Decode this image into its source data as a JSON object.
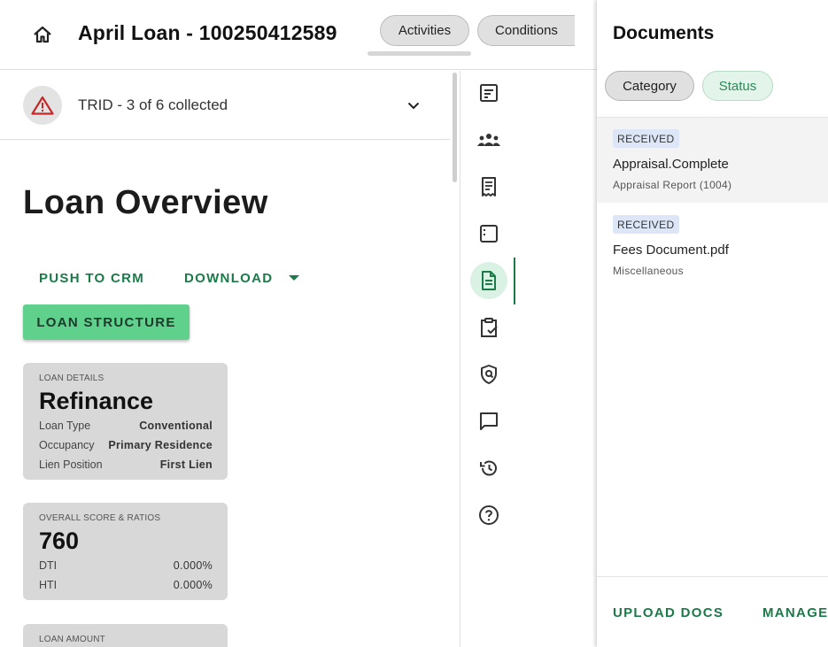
{
  "header": {
    "loan_title": "April Loan - 100250412589",
    "tabs": [
      {
        "label": "Activities"
      },
      {
        "label": "Conditions"
      }
    ]
  },
  "trid": {
    "status_text": "TRID - 3 of 6 collected"
  },
  "main": {
    "title": "Loan Overview",
    "actions": {
      "push_label": "PUSH TO CRM",
      "download_label": "DOWNLOAD",
      "structure_label": "LOAN STRUCTURE"
    },
    "cards": {
      "details": {
        "label": "LOAN DETAILS",
        "headline": "Refinance",
        "rows": [
          {
            "key": "Loan Type",
            "value": "Conventional"
          },
          {
            "key": "Occupancy",
            "value": "Primary Residence"
          },
          {
            "key": "Lien Position",
            "value": "First Lien"
          }
        ]
      },
      "score": {
        "label": "OVERALL SCORE & RATIOS",
        "headline": "760",
        "rows": [
          {
            "key": "DTI",
            "value": "0.000%"
          },
          {
            "key": "HTI",
            "value": "0.000%"
          }
        ]
      },
      "amount": {
        "label": "LOAN AMOUNT"
      }
    }
  },
  "rail": {
    "icons": [
      "summary-icon",
      "people-icon",
      "receipt-icon",
      "document-outline-icon",
      "documents-icon",
      "clipboard-check-icon",
      "shield-search-icon",
      "chat-icon",
      "history-icon",
      "help-icon"
    ],
    "active_index": 4,
    "accent_color": "#1a7a48"
  },
  "documents": {
    "title": "Documents",
    "filters": [
      {
        "label": "Category"
      },
      {
        "label": "Status"
      }
    ],
    "items": [
      {
        "status": "RECEIVED",
        "name": "Appraisal.Complete",
        "category": "Appraisal Report (1004)"
      },
      {
        "status": "RECEIVED",
        "name": "Fees Document.pdf",
        "category": "Miscellaneous"
      }
    ],
    "footer": {
      "upload_label": "UPLOAD DOCS",
      "manage_label": "MANAGE"
    }
  },
  "colors": {
    "accent_green": "#1a7a48",
    "button_green": "#5fd18d",
    "warning_red": "#c62828"
  }
}
